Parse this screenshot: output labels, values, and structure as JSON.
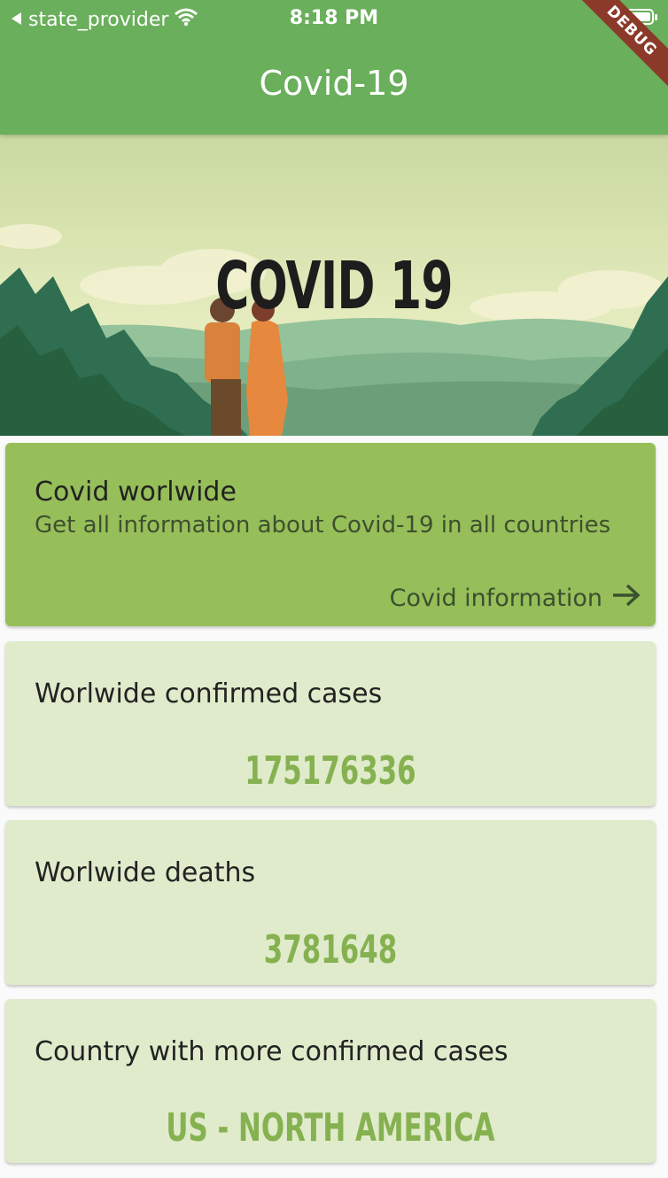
{
  "status_bar": {
    "carrier": "state_provider",
    "time": "8:18 PM"
  },
  "app_bar": {
    "title": "Covid-19",
    "debug_banner": "DEBUG"
  },
  "hero": {
    "title": "COVID 19"
  },
  "info_card": {
    "title": "Covid worlwide",
    "subtitle": "Get all information about Covid-19 in all countries",
    "link_label": "Covid information"
  },
  "stats": [
    {
      "label": "Worlwide confirmed cases",
      "value": "175176336"
    },
    {
      "label": "Worlwide deaths",
      "value": "3781648"
    },
    {
      "label": "Country with more confirmed cases",
      "value": "US - NORTH AMERICA"
    }
  ],
  "colors": {
    "app_bar": "#6aaf5b",
    "info_card": "#96bf5a",
    "stat_card": "#dfebcb",
    "stat_value": "#86b150",
    "debug_banner": "#8b3a2a"
  },
  "icons": [
    "back-caret-icon",
    "wifi-icon",
    "battery-icon",
    "arrow-right-icon"
  ]
}
